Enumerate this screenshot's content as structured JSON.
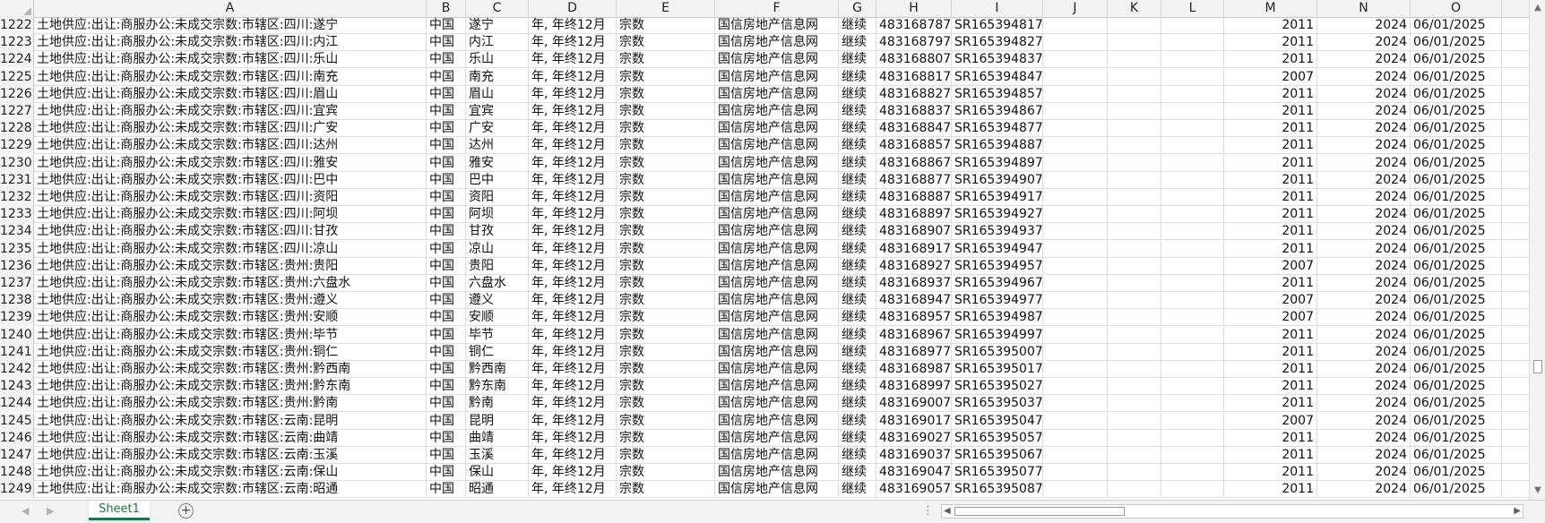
{
  "columns": [
    "A",
    "B",
    "C",
    "D",
    "E",
    "F",
    "G",
    "H",
    "I",
    "J",
    "K",
    "L",
    "M",
    "N",
    "O"
  ],
  "rows": [
    {
      "n": "1222",
      "a": "土地供应:出让:商服办公:未成交宗数:市辖区:四川:遂宁",
      "b": "中国",
      "c": "遂宁",
      "d": "年, 年终12月",
      "e": "宗数",
      "f": "国信房地产信息网",
      "g": "继续",
      "h": "483168787",
      "i": "SR165394817",
      "m": "2011",
      "nn": "2024",
      "o": "06/01/2025"
    },
    {
      "n": "1223",
      "a": "土地供应:出让:商服办公:未成交宗数:市辖区:四川:内江",
      "b": "中国",
      "c": "内江",
      "d": "年, 年终12月",
      "e": "宗数",
      "f": "国信房地产信息网",
      "g": "继续",
      "h": "483168797",
      "i": "SR165394827",
      "m": "2011",
      "nn": "2024",
      "o": "06/01/2025"
    },
    {
      "n": "1224",
      "a": "土地供应:出让:商服办公:未成交宗数:市辖区:四川:乐山",
      "b": "中国",
      "c": "乐山",
      "d": "年, 年终12月",
      "e": "宗数",
      "f": "国信房地产信息网",
      "g": "继续",
      "h": "483168807",
      "i": "SR165394837",
      "m": "2011",
      "nn": "2024",
      "o": "06/01/2025"
    },
    {
      "n": "1225",
      "a": "土地供应:出让:商服办公:未成交宗数:市辖区:四川:南充",
      "b": "中国",
      "c": "南充",
      "d": "年, 年终12月",
      "e": "宗数",
      "f": "国信房地产信息网",
      "g": "继续",
      "h": "483168817",
      "i": "SR165394847",
      "m": "2007",
      "nn": "2024",
      "o": "06/01/2025"
    },
    {
      "n": "1226",
      "a": "土地供应:出让:商服办公:未成交宗数:市辖区:四川:眉山",
      "b": "中国",
      "c": "眉山",
      "d": "年, 年终12月",
      "e": "宗数",
      "f": "国信房地产信息网",
      "g": "继续",
      "h": "483168827",
      "i": "SR165394857",
      "m": "2011",
      "nn": "2024",
      "o": "06/01/2025"
    },
    {
      "n": "1227",
      "a": "土地供应:出让:商服办公:未成交宗数:市辖区:四川:宜宾",
      "b": "中国",
      "c": "宜宾",
      "d": "年, 年终12月",
      "e": "宗数",
      "f": "国信房地产信息网",
      "g": "继续",
      "h": "483168837",
      "i": "SR165394867",
      "m": "2011",
      "nn": "2024",
      "o": "06/01/2025"
    },
    {
      "n": "1228",
      "a": "土地供应:出让:商服办公:未成交宗数:市辖区:四川:广安",
      "b": "中国",
      "c": "广安",
      "d": "年, 年终12月",
      "e": "宗数",
      "f": "国信房地产信息网",
      "g": "继续",
      "h": "483168847",
      "i": "SR165394877",
      "m": "2011",
      "nn": "2024",
      "o": "06/01/2025"
    },
    {
      "n": "1229",
      "a": "土地供应:出让:商服办公:未成交宗数:市辖区:四川:达州",
      "b": "中国",
      "c": "达州",
      "d": "年, 年终12月",
      "e": "宗数",
      "f": "国信房地产信息网",
      "g": "继续",
      "h": "483168857",
      "i": "SR165394887",
      "m": "2011",
      "nn": "2024",
      "o": "06/01/2025"
    },
    {
      "n": "1230",
      "a": "土地供应:出让:商服办公:未成交宗数:市辖区:四川:雅安",
      "b": "中国",
      "c": "雅安",
      "d": "年, 年终12月",
      "e": "宗数",
      "f": "国信房地产信息网",
      "g": "继续",
      "h": "483168867",
      "i": "SR165394897",
      "m": "2011",
      "nn": "2024",
      "o": "06/01/2025"
    },
    {
      "n": "1231",
      "a": "土地供应:出让:商服办公:未成交宗数:市辖区:四川:巴中",
      "b": "中国",
      "c": "巴中",
      "d": "年, 年终12月",
      "e": "宗数",
      "f": "国信房地产信息网",
      "g": "继续",
      "h": "483168877",
      "i": "SR165394907",
      "m": "2011",
      "nn": "2024",
      "o": "06/01/2025"
    },
    {
      "n": "1232",
      "a": "土地供应:出让:商服办公:未成交宗数:市辖区:四川:资阳",
      "b": "中国",
      "c": "资阳",
      "d": "年, 年终12月",
      "e": "宗数",
      "f": "国信房地产信息网",
      "g": "继续",
      "h": "483168887",
      "i": "SR165394917",
      "m": "2011",
      "nn": "2024",
      "o": "06/01/2025"
    },
    {
      "n": "1233",
      "a": "土地供应:出让:商服办公:未成交宗数:市辖区:四川:阿坝",
      "b": "中国",
      "c": "阿坝",
      "d": "年, 年终12月",
      "e": "宗数",
      "f": "国信房地产信息网",
      "g": "继续",
      "h": "483168897",
      "i": "SR165394927",
      "m": "2011",
      "nn": "2024",
      "o": "06/01/2025"
    },
    {
      "n": "1234",
      "a": "土地供应:出让:商服办公:未成交宗数:市辖区:四川:甘孜",
      "b": "中国",
      "c": "甘孜",
      "d": "年, 年终12月",
      "e": "宗数",
      "f": "国信房地产信息网",
      "g": "继续",
      "h": "483168907",
      "i": "SR165394937",
      "m": "2011",
      "nn": "2024",
      "o": "06/01/2025"
    },
    {
      "n": "1235",
      "a": "土地供应:出让:商服办公:未成交宗数:市辖区:四川:凉山",
      "b": "中国",
      "c": "凉山",
      "d": "年, 年终12月",
      "e": "宗数",
      "f": "国信房地产信息网",
      "g": "继续",
      "h": "483168917",
      "i": "SR165394947",
      "m": "2011",
      "nn": "2024",
      "o": "06/01/2025"
    },
    {
      "n": "1236",
      "a": "土地供应:出让:商服办公:未成交宗数:市辖区:贵州:贵阳",
      "b": "中国",
      "c": "贵阳",
      "d": "年, 年终12月",
      "e": "宗数",
      "f": "国信房地产信息网",
      "g": "继续",
      "h": "483168927",
      "i": "SR165394957",
      "m": "2007",
      "nn": "2024",
      "o": "06/01/2025"
    },
    {
      "n": "1237",
      "a": "土地供应:出让:商服办公:未成交宗数:市辖区:贵州:六盘水",
      "b": "中国",
      "c": "六盘水",
      "d": "年, 年终12月",
      "e": "宗数",
      "f": "国信房地产信息网",
      "g": "继续",
      "h": "483168937",
      "i": "SR165394967",
      "m": "2011",
      "nn": "2024",
      "o": "06/01/2025"
    },
    {
      "n": "1238",
      "a": "土地供应:出让:商服办公:未成交宗数:市辖区:贵州:遵义",
      "b": "中国",
      "c": "遵义",
      "d": "年, 年终12月",
      "e": "宗数",
      "f": "国信房地产信息网",
      "g": "继续",
      "h": "483168947",
      "i": "SR165394977",
      "m": "2007",
      "nn": "2024",
      "o": "06/01/2025"
    },
    {
      "n": "1239",
      "a": "土地供应:出让:商服办公:未成交宗数:市辖区:贵州:安顺",
      "b": "中国",
      "c": "安顺",
      "d": "年, 年终12月",
      "e": "宗数",
      "f": "国信房地产信息网",
      "g": "继续",
      "h": "483168957",
      "i": "SR165394987",
      "m": "2007",
      "nn": "2024",
      "o": "06/01/2025"
    },
    {
      "n": "1240",
      "a": "土地供应:出让:商服办公:未成交宗数:市辖区:贵州:毕节",
      "b": "中国",
      "c": "毕节",
      "d": "年, 年终12月",
      "e": "宗数",
      "f": "国信房地产信息网",
      "g": "继续",
      "h": "483168967",
      "i": "SR165394997",
      "m": "2011",
      "nn": "2024",
      "o": "06/01/2025"
    },
    {
      "n": "1241",
      "a": "土地供应:出让:商服办公:未成交宗数:市辖区:贵州:铜仁",
      "b": "中国",
      "c": "铜仁",
      "d": "年, 年终12月",
      "e": "宗数",
      "f": "国信房地产信息网",
      "g": "继续",
      "h": "483168977",
      "i": "SR165395007",
      "m": "2011",
      "nn": "2024",
      "o": "06/01/2025"
    },
    {
      "n": "1242",
      "a": "土地供应:出让:商服办公:未成交宗数:市辖区:贵州:黔西南",
      "b": "中国",
      "c": "黔西南",
      "d": "年, 年终12月",
      "e": "宗数",
      "f": "国信房地产信息网",
      "g": "继续",
      "h": "483168987",
      "i": "SR165395017",
      "m": "2011",
      "nn": "2024",
      "o": "06/01/2025"
    },
    {
      "n": "1243",
      "a": "土地供应:出让:商服办公:未成交宗数:市辖区:贵州:黔东南",
      "b": "中国",
      "c": "黔东南",
      "d": "年, 年终12月",
      "e": "宗数",
      "f": "国信房地产信息网",
      "g": "继续",
      "h": "483168997",
      "i": "SR165395027",
      "m": "2011",
      "nn": "2024",
      "o": "06/01/2025"
    },
    {
      "n": "1244",
      "a": "土地供应:出让:商服办公:未成交宗数:市辖区:贵州:黔南",
      "b": "中国",
      "c": "黔南",
      "d": "年, 年终12月",
      "e": "宗数",
      "f": "国信房地产信息网",
      "g": "继续",
      "h": "483169007",
      "i": "SR165395037",
      "m": "2011",
      "nn": "2024",
      "o": "06/01/2025"
    },
    {
      "n": "1245",
      "a": "土地供应:出让:商服办公:未成交宗数:市辖区:云南:昆明",
      "b": "中国",
      "c": "昆明",
      "d": "年, 年终12月",
      "e": "宗数",
      "f": "国信房地产信息网",
      "g": "继续",
      "h": "483169017",
      "i": "SR165395047",
      "m": "2007",
      "nn": "2024",
      "o": "06/01/2025"
    },
    {
      "n": "1246",
      "a": "土地供应:出让:商服办公:未成交宗数:市辖区:云南:曲靖",
      "b": "中国",
      "c": "曲靖",
      "d": "年, 年终12月",
      "e": "宗数",
      "f": "国信房地产信息网",
      "g": "继续",
      "h": "483169027",
      "i": "SR165395057",
      "m": "2011",
      "nn": "2024",
      "o": "06/01/2025"
    },
    {
      "n": "1247",
      "a": "土地供应:出让:商服办公:未成交宗数:市辖区:云南:玉溪",
      "b": "中国",
      "c": "玉溪",
      "d": "年, 年终12月",
      "e": "宗数",
      "f": "国信房地产信息网",
      "g": "继续",
      "h": "483169037",
      "i": "SR165395067",
      "m": "2011",
      "nn": "2024",
      "o": "06/01/2025"
    },
    {
      "n": "1248",
      "a": "土地供应:出让:商服办公:未成交宗数:市辖区:云南:保山",
      "b": "中国",
      "c": "保山",
      "d": "年, 年终12月",
      "e": "宗数",
      "f": "国信房地产信息网",
      "g": "继续",
      "h": "483169047",
      "i": "SR165395077",
      "m": "2011",
      "nn": "2024",
      "o": "06/01/2025"
    },
    {
      "n": "1249",
      "a": "土地供应:出让:商服办公:未成交宗数:市辖区:云南:昭通",
      "b": "中国",
      "c": "昭通",
      "d": "年, 年终12月",
      "e": "宗数",
      "f": "国信房地产信息网",
      "g": "继续",
      "h": "483169057",
      "i": "SR165395087",
      "m": "2011",
      "nn": "2024",
      "o": "06/01/2025"
    }
  ],
  "tabs": {
    "sheet1": "Sheet1",
    "add": "+"
  },
  "nav": {
    "prev": "◀",
    "next": "▶",
    "dots": "⋮",
    "up": "▲",
    "down": "▼",
    "left": "◀",
    "right": "▶"
  },
  "colors": {
    "accent": "#217346"
  }
}
